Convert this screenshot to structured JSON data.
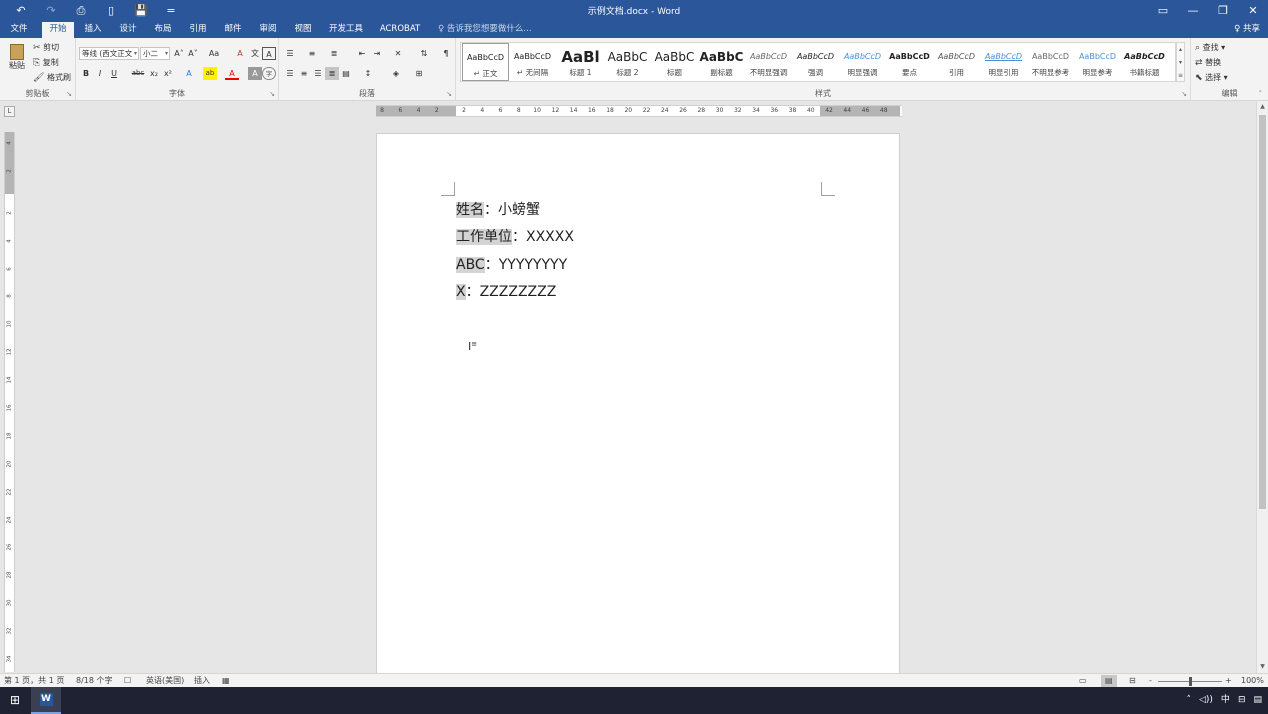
{
  "window": {
    "title": "示例文档.docx - Word",
    "qat": {
      "undo": "↶",
      "redo": "↷",
      "print_preview": "⎙",
      "new_doc": "▯",
      "save": "💾",
      "customize": "="
    },
    "controls": {
      "ribbon_display": "▭",
      "minimize": "—",
      "restore": "❐",
      "close": "✕"
    }
  },
  "tabs": {
    "file": "文件",
    "home": "开始",
    "insert": "插入",
    "design": "设计",
    "layout": "布局",
    "references": "引用",
    "mailings": "邮件",
    "review": "审阅",
    "view": "视图",
    "developer": "开发工具",
    "acrobat": "ACROBAT",
    "tell_me": "♀ 告诉我您想要做什么...",
    "share": "♀ 共享"
  },
  "ribbon": {
    "clipboard": {
      "label": "剪贴板",
      "paste": "粘贴",
      "cut": "剪切",
      "copy": "复制",
      "format_painter": "格式刷"
    },
    "font": {
      "label": "字体",
      "font_name": "等线 (西文正文",
      "font_size": "小二",
      "grow": "A˄",
      "shrink": "A˅",
      "change_case": "Aa",
      "clear_format": "A",
      "phonetic": "文",
      "char_border": "A",
      "bold": "B",
      "italic": "I",
      "underline": "U",
      "strike": "abc",
      "subscript": "x₂",
      "superscript": "x²",
      "text_effects": "A",
      "highlight": "ab",
      "font_color": "A",
      "char_shading": "A",
      "enclose": "字"
    },
    "paragraph": {
      "label": "段落"
    },
    "styles": {
      "label": "样式",
      "items": [
        {
          "preview": "AaBbCcD",
          "name": "↵ 正文"
        },
        {
          "preview": "AaBbCcD",
          "name": "↵ 无间隔"
        },
        {
          "preview": "AaBl",
          "name": "标题 1"
        },
        {
          "preview": "AaBbC",
          "name": "标题 2"
        },
        {
          "preview": "AaBbC",
          "name": "标题"
        },
        {
          "preview": "AaBbC",
          "name": "副标题"
        },
        {
          "preview": "AaBbCcD",
          "name": "不明显强调"
        },
        {
          "preview": "AaBbCcD",
          "name": "强调"
        },
        {
          "preview": "AaBbCcD",
          "name": "明显强调"
        },
        {
          "preview": "AaBbCcD",
          "name": "要点"
        },
        {
          "preview": "AaBbCcD",
          "name": "引用"
        },
        {
          "preview": "AaBbCcD",
          "name": "明显引用"
        },
        {
          "preview": "AaBbCcD",
          "name": "不明显参考"
        },
        {
          "preview": "AaBbCcD",
          "name": "明显参考"
        },
        {
          "preview": "AaBbCcD",
          "name": "书籍标题"
        }
      ]
    },
    "editing": {
      "label": "编辑",
      "find": "查找",
      "replace": "替换",
      "select": "选择"
    }
  },
  "ruler": {
    "horizontal_ticks": [
      "8",
      "6",
      "4",
      "2",
      "2",
      "4",
      "6",
      "8",
      "10",
      "12",
      "14",
      "16",
      "18",
      "20",
      "22",
      "24",
      "26",
      "28",
      "30",
      "32",
      "34",
      "36",
      "38",
      "40",
      "42",
      "44",
      "46",
      "48"
    ],
    "vertical_ticks": [
      "4",
      "2",
      "2",
      "4",
      "6",
      "8",
      "10",
      "12",
      "14",
      "16",
      "18",
      "20",
      "22",
      "24",
      "26",
      "28",
      "30",
      "32",
      "34"
    ]
  },
  "document": {
    "lines": [
      {
        "label": "姓名",
        "sep": "：",
        "value": "小螃蟹"
      },
      {
        "label": "工作单位",
        "sep": "：",
        "value": "XXXXX"
      },
      {
        "label": "ABC",
        "sep": "：",
        "value": "YYYYYYYY"
      },
      {
        "label": "X",
        "sep": "：",
        "value": "ZZZZZZZZ"
      }
    ],
    "caret": "I"
  },
  "statusbar": {
    "page": "第 1 页，共 1 页",
    "words": "8/18 个字",
    "language": "英语(美国)",
    "mode": "插入",
    "zoom": "100%",
    "zoom_minus": "-",
    "zoom_plus": "+"
  },
  "taskbar": {
    "start": "⊞",
    "app_letter": "W",
    "tray": {
      "chevron": "˄",
      "volume": "◁))",
      "ime": "中",
      "layout": "⊟",
      "notify": "▤"
    }
  },
  "colors": {
    "accent": "#2b579a",
    "selection": "#d4d4d4"
  }
}
